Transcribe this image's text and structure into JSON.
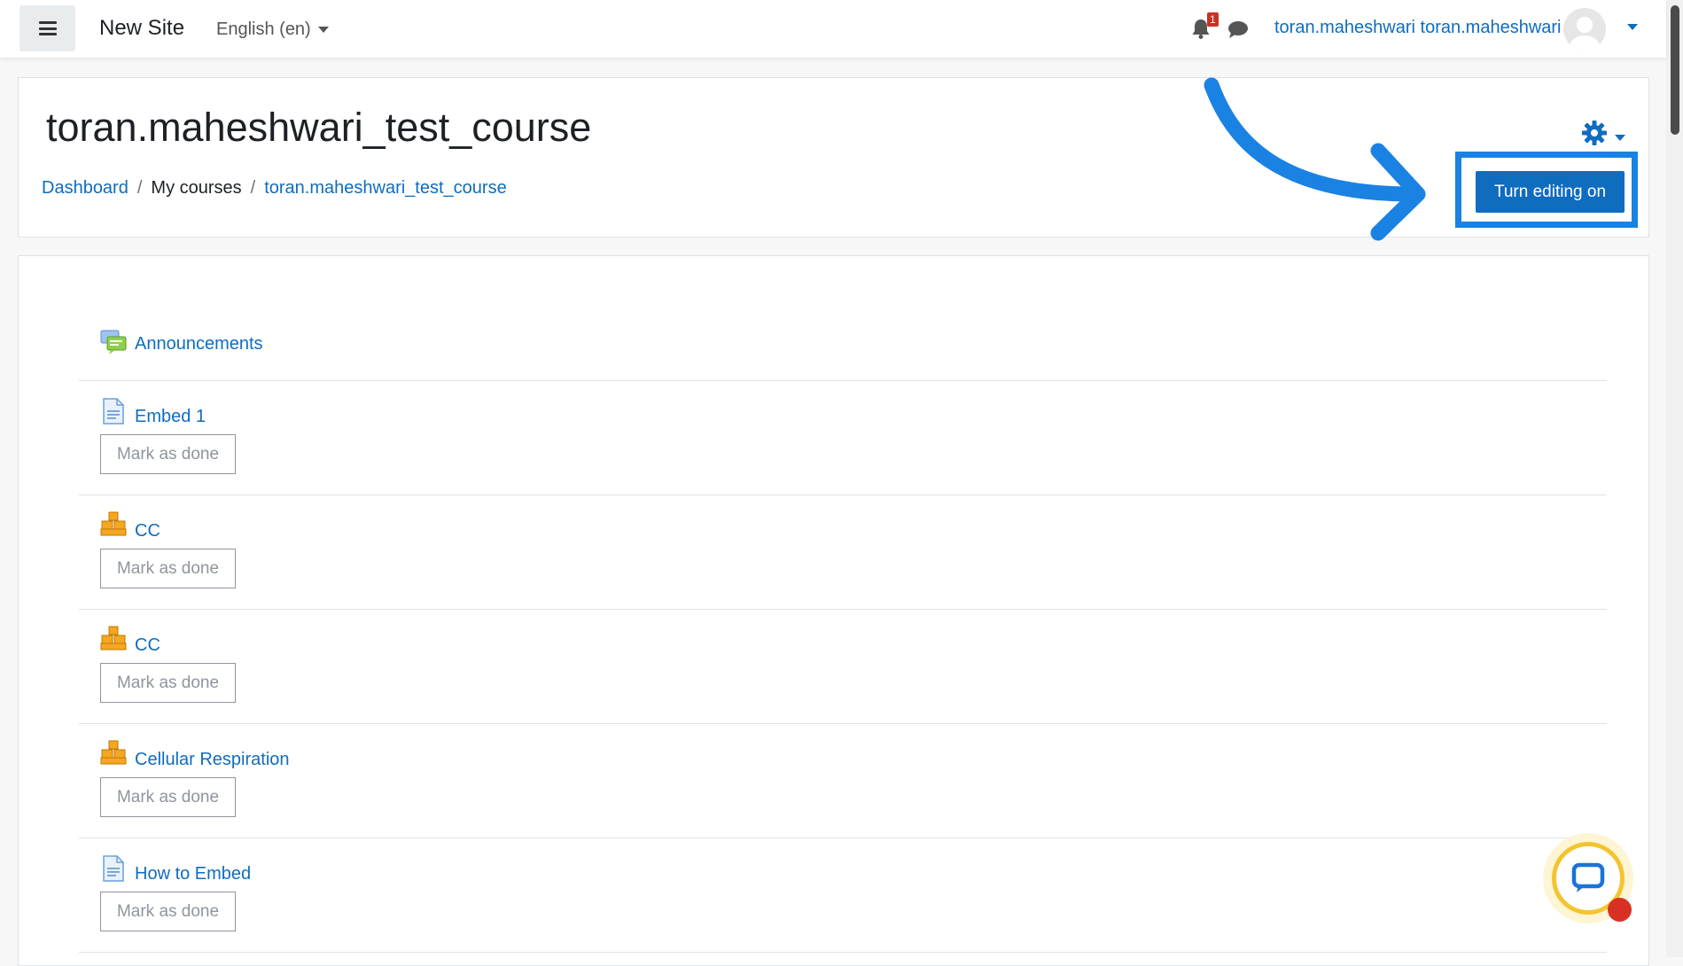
{
  "navbar": {
    "site_name": "New Site",
    "language": "English (en)",
    "notification_count": "1",
    "user_name": "toran.maheshwari toran.maheshwari"
  },
  "header": {
    "course_title": "toran.maheshwari_test_course",
    "breadcrumb": [
      "Dashboard",
      "My courses",
      "toran.maheshwari_test_course"
    ],
    "edit_button_label": "Turn editing on"
  },
  "activities": [
    {
      "label": "Announcements",
      "icon": "forum-icon",
      "mark_label": ""
    },
    {
      "label": "Embed 1",
      "icon": "page-icon",
      "mark_label": "Mark as done"
    },
    {
      "label": "CC",
      "icon": "package-icon",
      "mark_label": "Mark as done"
    },
    {
      "label": "CC",
      "icon": "package-icon",
      "mark_label": "Mark as done"
    },
    {
      "label": "Cellular Respiration",
      "icon": "package-icon",
      "mark_label": "Mark as done"
    },
    {
      "label": "How to Embed",
      "icon": "page-icon",
      "mark_label": "Mark as done"
    }
  ],
  "colors": {
    "link": "#0f6cbf",
    "primary_button": "#0f6cbf",
    "annotation": "#1a82e2",
    "badge": "#ca3120"
  }
}
